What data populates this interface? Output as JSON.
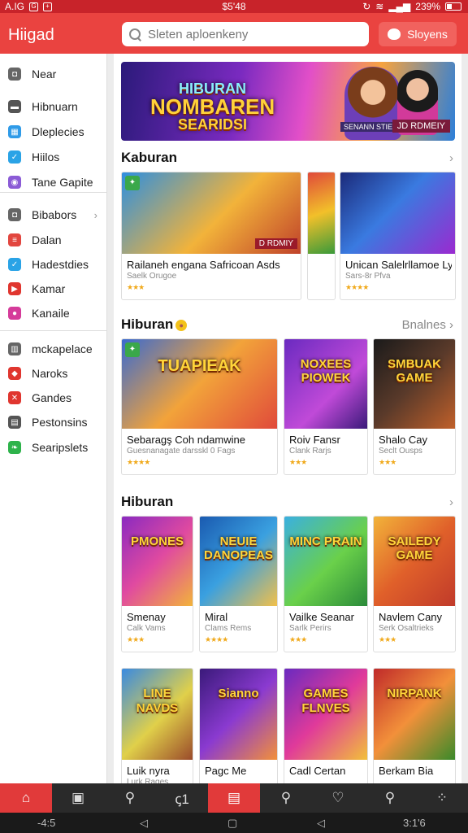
{
  "status_bar": {
    "left_text": "A.IG",
    "left_icon1": "G",
    "left_icon2": "+",
    "time": "$5'48",
    "right_text": "239%"
  },
  "app": {
    "title": "Hiigad"
  },
  "search": {
    "placeholder": "Sleten aploenkeny"
  },
  "header": {
    "signin_label": "Sloyens"
  },
  "sidebar": {
    "items": [
      {
        "label": "Near",
        "icon": "camera-icon",
        "color": "#666666"
      },
      {
        "label": "Hibnuarn",
        "icon": "briefcase-icon",
        "color": "#555555"
      },
      {
        "label": "Dleplecies",
        "icon": "grid-icon",
        "color": "#2f9be8"
      },
      {
        "label": "Hiilos",
        "icon": "check-icon",
        "color": "#2aa3e6"
      },
      {
        "label": "Tane Gapite",
        "icon": "gamepad-icon",
        "color": "#8b5bd6"
      },
      {
        "label": "Bibabors",
        "icon": "camera-icon",
        "color": "#666666"
      },
      {
        "label": "Dalan",
        "icon": "list-icon",
        "color": "#e2463f"
      },
      {
        "label": "Hadestdies",
        "icon": "check-icon",
        "color": "#2aa3e6"
      },
      {
        "label": "Kamar",
        "icon": "play-icon",
        "color": "#e0362f"
      },
      {
        "label": "Kanaile",
        "icon": "circle-icon",
        "color": "#d53b9a"
      },
      {
        "label": "mckapelace",
        "icon": "store-icon",
        "color": "#666666"
      },
      {
        "label": "Naroks",
        "icon": "shield-icon",
        "color": "#e0362f"
      },
      {
        "label": "Gandes",
        "icon": "close-icon",
        "color": "#e0362f"
      },
      {
        "label": "Pestonsins",
        "icon": "calendar-icon",
        "color": "#555555"
      },
      {
        "label": "Searipslets",
        "icon": "leaf-icon",
        "color": "#2eb34b"
      }
    ]
  },
  "banner": {
    "line1": "HIBURAN",
    "line2": "NOMBAREN",
    "line3": "SEARIDSI",
    "subtag": "SENANN STIEDSDE",
    "tag": "JD RDMEIY"
  },
  "sections": [
    {
      "title": "Kaburan",
      "more": "",
      "cards": [
        {
          "title": "Railaneh engana Safricoan Asds",
          "sub": "Saelk Orugoe",
          "stars": "★★★",
          "ribbon": "D RDMIY",
          "gradient": "linear-gradient(135deg,#2d8fe0,#f2b33a 55%,#c0422a)"
        },
        {
          "title": "",
          "sub": "",
          "stars": "",
          "ribbon": "",
          "gradient": "linear-gradient(160deg,#e04a3a,#f2c02a 50%,#3a9a3a)"
        },
        {
          "title": "Unican Salelrllamoe Lyiints",
          "sub": "Sars-8r Pfva",
          "stars": "★★★★",
          "ribbon": "",
          "gradient": "linear-gradient(135deg,#1b2a7a,#3a7ae0 45%,#9a2ad0)"
        }
      ]
    },
    {
      "title": "Hiburan",
      "more": "Bnalnes",
      "cards": [
        {
          "title": "Sebaragş Coh ndamwine",
          "sub": "Guesnanagate darsskl 0 Fags",
          "stars": "★★★★",
          "label": "TUAPIEAK",
          "gradient": "linear-gradient(135deg,#3a6ad0,#f2a33a 50%,#e04a3a)"
        },
        {
          "title": "Roiv Fansr",
          "sub": "Clank Rarjs",
          "stars": "★★★",
          "label": "NOXEES PIOWEK",
          "gradient": "linear-gradient(135deg,#6a2ac0,#c04ad8 60%,#3a1a7a)"
        },
        {
          "title": "Shalo Cay",
          "sub": "Seclt Ousps",
          "stars": "★★★",
          "label": "SMBUAK GAME",
          "gradient": "linear-gradient(135deg,#1a1a1a,#5a3a2a 50%,#c0602a)"
        }
      ]
    },
    {
      "title": "Hiburan",
      "more": "",
      "cards": [
        {
          "title": "Smenay",
          "sub": "Calk Vams",
          "stars": "★★★",
          "label": "PMONES",
          "gradient": "linear-gradient(135deg,#8a2ac0,#e04aa0 50%,#f2b33a)"
        },
        {
          "title": "Miral",
          "sub": "Clams Rems",
          "stars": "★★★★",
          "label": "NEUIE DANOPEAS",
          "gradient": "linear-gradient(135deg,#1a5ab0,#3aa0e0 50%,#f2c04a)"
        },
        {
          "title": "Vailke Seanar",
          "sub": "Sarlk Perirs",
          "stars": "★★★",
          "label": "MINC PRAIN",
          "gradient": "linear-gradient(135deg,#3ab0e0,#6ad04a 55%,#2a8a3a)"
        },
        {
          "title": "Navlem Cany",
          "sub": "Serk Osaltrieks",
          "stars": "★★★",
          "label": "SAILEDY GAME",
          "gradient": "linear-gradient(135deg,#f2b33a,#e0602a 50%,#c03a2a)"
        }
      ]
    },
    {
      "title": "",
      "more": "",
      "cards": [
        {
          "title": "Luik nyra",
          "sub": "Lurk Rages",
          "stars": "",
          "label": "LINE NAVDS",
          "gradient": "linear-gradient(135deg,#3a8ae0,#e0d04a 55%,#9a4a2a)"
        },
        {
          "title": "Pagc Me",
          "sub": "",
          "stars": "",
          "label": "Sianno",
          "gradient": "linear-gradient(135deg,#3a1a7a,#8a3ad0 50%,#f2903a)"
        },
        {
          "title": "Cadl Certan",
          "sub": "",
          "stars": "",
          "label": "GAMES FLNVES",
          "gradient": "linear-gradient(135deg,#6a2ac0,#e03a9a 50%,#f2c03a)"
        },
        {
          "title": "Berkam Bia",
          "sub": "",
          "stars": "",
          "label": "NIRPANK",
          "gradient": "linear-gradient(135deg,#c02a2a,#f2903a 50%,#3a8a2a)"
        }
      ]
    }
  ],
  "bottom_nav": {
    "items": [
      {
        "icon": "home-icon",
        "glyph": "⌂",
        "active": true
      },
      {
        "icon": "puzzle-icon",
        "glyph": "▣",
        "active": false
      },
      {
        "icon": "search-icon",
        "glyph": "⚲",
        "active": false
      },
      {
        "icon": "chat-icon",
        "glyph": "ꞔ1",
        "active": false
      },
      {
        "icon": "library-icon",
        "glyph": "▤",
        "active": true
      },
      {
        "icon": "search-icon",
        "glyph": "⚲",
        "active": false
      },
      {
        "icon": "heart-icon",
        "glyph": "♡",
        "active": false
      },
      {
        "icon": "search-icon",
        "glyph": "⚲",
        "active": false
      },
      {
        "icon": "apps-icon",
        "glyph": "⁘",
        "active": false
      }
    ]
  },
  "system_nav": {
    "left": "-4:5",
    "right": "3:1'6"
  },
  "colors": {
    "brand": "#ea4340",
    "status": "#c8232a",
    "accent_star": "#f0a91b"
  }
}
